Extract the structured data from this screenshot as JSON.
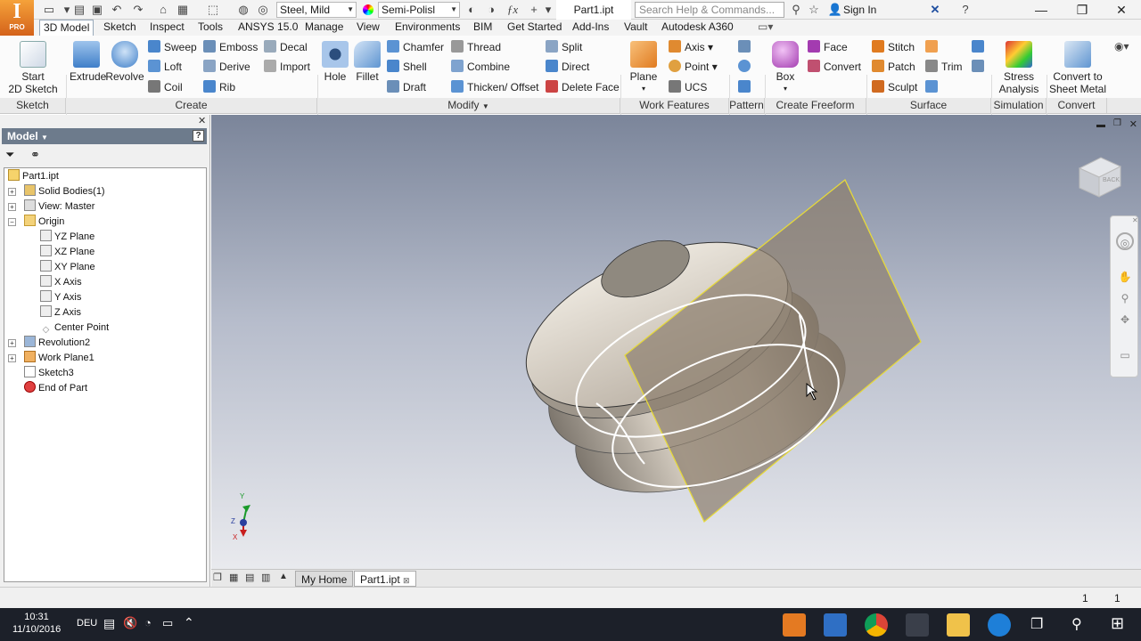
{
  "app": {
    "logo_text": "I",
    "logo_sub": "PRO"
  },
  "titlebar": {
    "material": "Steel, Mild",
    "appearance": "Semi-Polisl",
    "document_title": "Part1.ipt",
    "search_placeholder": "Search Help & Commands...",
    "sign_in": "Sign In"
  },
  "tabs": [
    "3D Model",
    "Sketch",
    "Inspect",
    "Tools",
    "ANSYS 15.0",
    "Manage",
    "View",
    "Environments",
    "BIM",
    "Get Started",
    "Add-Ins",
    "Vault",
    "Autodesk A360"
  ],
  "active_tab": "3D Model",
  "ribbon": {
    "sketch": {
      "start_line1": "Start",
      "start_line2": "2D Sketch",
      "panel": "Sketch"
    },
    "create": {
      "extrude": "Extrude",
      "revolve": "Revolve",
      "sweep": "Sweep",
      "loft": "Loft",
      "coil": "Coil",
      "emboss": "Emboss",
      "derive": "Derive",
      "rib": "Rib",
      "decal": "Decal",
      "import": "Import",
      "panel": "Create"
    },
    "modify": {
      "hole": "Hole",
      "fillet": "Fillet",
      "chamfer": "Chamfer",
      "shell": "Shell",
      "draft": "Draft",
      "thread": "Thread",
      "combine": "Combine",
      "thicken": "Thicken/ Offset",
      "split": "Split",
      "direct": "Direct",
      "delete_face": "Delete Face",
      "panel": "Modify"
    },
    "work_features": {
      "plane": "Plane",
      "axis": "Axis",
      "point": "Point",
      "ucs": "UCS",
      "panel": "Work Features"
    },
    "pattern": {
      "panel": "Pattern"
    },
    "freeform": {
      "box": "Box",
      "face": "Face",
      "convert": "Convert",
      "panel": "Create Freeform"
    },
    "surface": {
      "stitch": "Stitch",
      "patch": "Patch",
      "sculpt": "Sculpt",
      "trim": "Trim",
      "panel": "Surface"
    },
    "simulation": {
      "line1": "Stress",
      "line2": "Analysis",
      "panel": "Simulation"
    },
    "convert": {
      "line1": "Convert to",
      "line2": "Sheet Metal",
      "panel": "Convert"
    }
  },
  "browser": {
    "title": "Model",
    "nodes": [
      {
        "label": "Part1.ipt"
      },
      {
        "label": "Solid Bodies(1)"
      },
      {
        "label": "View: Master"
      },
      {
        "label": "Origin"
      },
      {
        "label": "YZ Plane"
      },
      {
        "label": "XZ Plane"
      },
      {
        "label": "XY Plane"
      },
      {
        "label": "X Axis"
      },
      {
        "label": "Y Axis"
      },
      {
        "label": "Z Axis"
      },
      {
        "label": "Center Point"
      },
      {
        "label": "Revolution2"
      },
      {
        "label": "Work Plane1"
      },
      {
        "label": "Sketch3"
      },
      {
        "label": "End of Part"
      }
    ]
  },
  "viewcube": {
    "face_label": "BACK"
  },
  "triad": {
    "x": "X",
    "y": "Y",
    "z": "Z"
  },
  "doc_tabs": {
    "home": "My Home",
    "part": "Part1.ipt"
  },
  "status": {
    "value1": "1",
    "value2": "1"
  },
  "taskbar": {
    "time": "10:31",
    "date": "11/10/2016",
    "lang": "DEU"
  },
  "colors": {
    "ribbon_bg": "#fbfbfb",
    "browser_header": "#6d7b8c",
    "viewport_top": "#7b859a",
    "viewport_bottom": "#e9eaee",
    "workplane": "#8e7f6f",
    "workplane_edge": "#e6d93a"
  }
}
